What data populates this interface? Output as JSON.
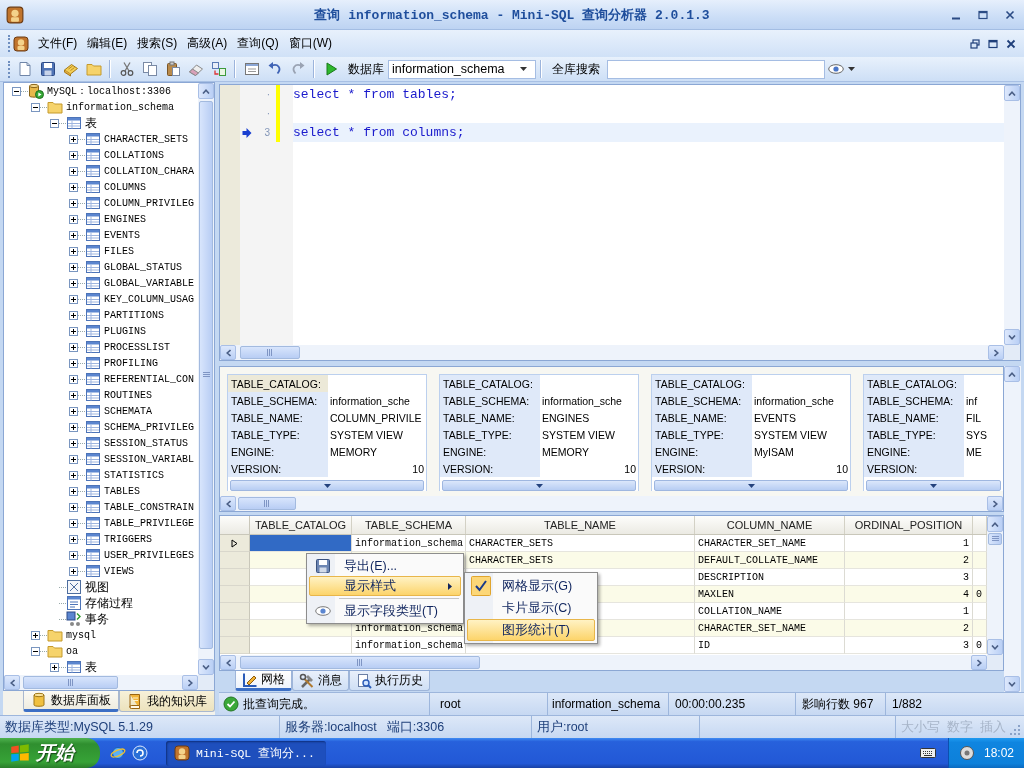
{
  "window": {
    "title": "查询 information_schema - Mini-SQL 查询分析器 2.0.1.3"
  },
  "menu_bar": {
    "items": [
      "文件(F)",
      "编辑(E)",
      "搜索(S)",
      "高级(A)",
      "查询(Q)",
      "窗口(W)"
    ]
  },
  "toolbar": {
    "database_label": "数据库",
    "database": "information_schema",
    "search_label": "全库搜索"
  },
  "tree": {
    "nodes": [
      {
        "label": "MySQL：localhost:3306",
        "kind": "server",
        "expanded": true,
        "children": [
          {
            "label": "information_schema",
            "kind": "database",
            "expanded": true,
            "children": [
              {
                "label": "表",
                "kind": "tables",
                "expanded": true,
                "children": [
                  {
                    "label": "CHARACTER_SETS",
                    "kind": "table",
                    "expanded": false
                  },
                  {
                    "label": "COLLATIONS",
                    "kind": "table",
                    "expanded": false
                  },
                  {
                    "label": "COLLATION_CHARA",
                    "kind": "table",
                    "expanded": false
                  },
                  {
                    "label": "COLUMNS",
                    "kind": "table",
                    "expanded": false
                  },
                  {
                    "label": "COLUMN_PRIVILEG",
                    "kind": "table",
                    "expanded": false
                  },
                  {
                    "label": "ENGINES",
                    "kind": "table",
                    "expanded": false
                  },
                  {
                    "label": "EVENTS",
                    "kind": "table",
                    "expanded": false
                  },
                  {
                    "label": "FILES",
                    "kind": "table",
                    "expanded": false
                  },
                  {
                    "label": "GLOBAL_STATUS",
                    "kind": "table",
                    "expanded": false
                  },
                  {
                    "label": "GLOBAL_VARIABLE",
                    "kind": "table",
                    "expanded": false
                  },
                  {
                    "label": "KEY_COLUMN_USAG",
                    "kind": "table",
                    "expanded": false
                  },
                  {
                    "label": "PARTITIONS",
                    "kind": "table",
                    "expanded": false
                  },
                  {
                    "label": "PLUGINS",
                    "kind": "table",
                    "expanded": false
                  },
                  {
                    "label": "PROCESSLIST",
                    "kind": "table",
                    "expanded": false
                  },
                  {
                    "label": "PROFILING",
                    "kind": "table",
                    "expanded": false
                  },
                  {
                    "label": "REFERENTIAL_CON",
                    "kind": "table",
                    "expanded": false
                  },
                  {
                    "label": "ROUTINES",
                    "kind": "table",
                    "expanded": false
                  },
                  {
                    "label": "SCHEMATA",
                    "kind": "table",
                    "expanded": false
                  },
                  {
                    "label": "SCHEMA_PRIVILEG",
                    "kind": "table",
                    "expanded": false
                  },
                  {
                    "label": "SESSION_STATUS",
                    "kind": "table",
                    "expanded": false
                  },
                  {
                    "label": "SESSION_VARIABL",
                    "kind": "table",
                    "expanded": false
                  },
                  {
                    "label": "STATISTICS",
                    "kind": "table",
                    "expanded": false
                  },
                  {
                    "label": "TABLES",
                    "kind": "table",
                    "expanded": false
                  },
                  {
                    "label": "TABLE_CONSTRAIN",
                    "kind": "table",
                    "expanded": false
                  },
                  {
                    "label": "TABLE_PRIVILEGE",
                    "kind": "table",
                    "expanded": false
                  },
                  {
                    "label": "TRIGGERS",
                    "kind": "table",
                    "expanded": false
                  },
                  {
                    "label": "USER_PRIVILEGES",
                    "kind": "table",
                    "expanded": false
                  },
                  {
                    "label": "VIEWS",
                    "kind": "table",
                    "expanded": false
                  }
                ]
              },
              {
                "label": "视图",
                "kind": "views"
              },
              {
                "label": "存储过程",
                "kind": "procedures"
              },
              {
                "label": "事务",
                "kind": "transactions"
              }
            ]
          },
          {
            "label": "mysql",
            "kind": "database",
            "expanded": false
          },
          {
            "label": "oa",
            "kind": "database",
            "expanded": true,
            "children": [
              {
                "label": "表",
                "kind": "tables",
                "expanded": false
              }
            ]
          }
        ]
      }
    ]
  },
  "panel_tabs": [
    {
      "label": "数据库面板",
      "selected": true
    },
    {
      "label": "我的知识库",
      "selected": false
    }
  ],
  "editor": {
    "lines": [
      {
        "number": "·",
        "code": "select * from tables;",
        "current": false,
        "modified": true
      },
      {
        "number": "·",
        "current": false,
        "modified": true
      },
      {
        "number": "3",
        "code": "select * from columns;",
        "current": true,
        "modified": true
      }
    ]
  },
  "cards": [
    {
      "fields": [
        {
          "label": "TABLE_CATALOG:",
          "kind": "text",
          "selected": true
        },
        {
          "label": "TABLE_SCHEMA:",
          "value": "information_sche",
          "kind": "text",
          "selected": false
        },
        {
          "label": "TABLE_NAME:",
          "value": "COLUMN_PRIVILE",
          "kind": "text",
          "selected": false
        },
        {
          "label": "TABLE_TYPE:",
          "value": "SYSTEM VIEW",
          "kind": "text",
          "selected": false
        },
        {
          "label": "ENGINE:",
          "value": "MEMORY",
          "kind": "text",
          "selected": false
        },
        {
          "label": "VERSION:",
          "value": "10",
          "kind": "number",
          "selected": false
        }
      ]
    },
    {
      "fields": [
        {
          "label": "TABLE_CATALOG:",
          "kind": "text",
          "selected": false
        },
        {
          "label": "TABLE_SCHEMA:",
          "value": "information_sche",
          "kind": "text",
          "selected": false
        },
        {
          "label": "TABLE_NAME:",
          "value": "ENGINES",
          "kind": "text",
          "selected": false
        },
        {
          "label": "TABLE_TYPE:",
          "value": "SYSTEM VIEW",
          "kind": "text",
          "selected": false
        },
        {
          "label": "ENGINE:",
          "value": "MEMORY",
          "kind": "text",
          "selected": false
        },
        {
          "label": "VERSION:",
          "value": "10",
          "kind": "number",
          "selected": false
        }
      ]
    },
    {
      "fields": [
        {
          "label": "TABLE_CATALOG:",
          "kind": "text",
          "selected": false
        },
        {
          "label": "TABLE_SCHEMA:",
          "value": "information_sche",
          "kind": "text",
          "selected": false
        },
        {
          "label": "TABLE_NAME:",
          "value": "EVENTS",
          "kind": "text",
          "selected": false
        },
        {
          "label": "TABLE_TYPE:",
          "value": "SYSTEM VIEW",
          "kind": "text",
          "selected": false
        },
        {
          "label": "ENGINE:",
          "value": "MyISAM",
          "kind": "text",
          "selected": false
        },
        {
          "label": "VERSION:",
          "value": "10",
          "kind": "number",
          "selected": false
        }
      ]
    },
    {
      "fields": [
        {
          "label": "TABLE_CATALOG:",
          "kind": "text",
          "selected": false
        },
        {
          "label": "TABLE_SCHEMA:",
          "value": "inf",
          "kind": "text",
          "selected": false
        },
        {
          "label": "TABLE_NAME:",
          "value": "FIL",
          "kind": "text",
          "selected": false
        },
        {
          "label": "TABLE_TYPE:",
          "value": "SYS",
          "kind": "text",
          "selected": false
        },
        {
          "label": "ENGINE:",
          "value": "ME",
          "kind": "text",
          "selected": false
        },
        {
          "label": "VERSION:",
          "kind": "number",
          "selected": false
        }
      ]
    }
  ],
  "grid": {
    "columns": [
      {
        "label": "TABLE_CATALOG",
        "kind": "text"
      },
      {
        "label": "TABLE_SCHEMA",
        "kind": "text"
      },
      {
        "label": "TABLE_NAME",
        "kind": "text"
      },
      {
        "label": "COLUMN_NAME",
        "kind": "text"
      },
      {
        "label": "ORDINAL_POSITION",
        "kind": "number"
      },
      {
        "kind": "text"
      }
    ],
    "rows": [
      {
        "selected": true,
        "cells": [
          null,
          "information_schema",
          "CHARACTER_SETS",
          "CHARACTER_SET_NAME",
          "1",
          null
        ]
      },
      {
        "selected": false,
        "cells": [
          null,
          null,
          "CHARACTER_SETS",
          "DEFAULT_COLLATE_NAME",
          "2",
          null
        ]
      },
      {
        "selected": false,
        "cells": [
          null,
          null,
          null,
          "DESCRIPTION",
          "3",
          null
        ]
      },
      {
        "selected": false,
        "cells": [
          null,
          null,
          null,
          "MAXLEN",
          "4",
          "0"
        ]
      },
      {
        "selected": false,
        "cells": [
          null,
          null,
          null,
          "COLLATION_NAME",
          "1",
          null
        ]
      },
      {
        "selected": false,
        "cells": [
          null,
          "information_schema",
          null,
          "CHARACTER_SET_NAME",
          "2",
          null
        ]
      },
      {
        "selected": false,
        "cells": [
          null,
          "information_schema",
          null,
          "ID",
          "3",
          "0"
        ]
      }
    ]
  },
  "context_menu": {
    "items": [
      {
        "kind": "command",
        "label": "导出(E)...",
        "highlighted": false
      },
      {
        "kind": "submenu",
        "label": "显示样式",
        "highlighted": true
      },
      {
        "kind": "separator"
      },
      {
        "kind": "command",
        "label": "显示字段类型(T)",
        "highlighted": false
      }
    ]
  },
  "submenu": {
    "items": [
      {
        "label": "网格显示(G)",
        "checked": true,
        "highlighted": false
      },
      {
        "label": "卡片显示(C)",
        "checked": false,
        "highlighted": false
      },
      {
        "label": "图形统计(T)",
        "checked": false,
        "highlighted": true
      }
    ]
  },
  "result_tabs": [
    {
      "label": "网格",
      "selected": true
    },
    {
      "label": "消息",
      "selected": false
    },
    {
      "label": "执行历史",
      "selected": false
    }
  ],
  "status_bar": {
    "message": "批查询完成。",
    "user": "root",
    "database": "information_schema",
    "elapsed": "00:00:00.235",
    "affected": "影响行数 967",
    "position": "1/882"
  },
  "info_bar": {
    "db_type": "数据库类型:MySQL 5.1.29",
    "server": "服务器:localhost",
    "port": "端口:3306",
    "user": "用户:root",
    "indicators": [
      {
        "label": "大小写",
        "on": false
      },
      {
        "label": "数字",
        "on": false
      },
      {
        "label": "插入",
        "on": false
      }
    ]
  },
  "taskbar": {
    "start": "开始",
    "tasks": [
      {
        "label": "Mini-SQL 查询分...",
        "selected": true
      }
    ],
    "clock": "18:02"
  }
}
